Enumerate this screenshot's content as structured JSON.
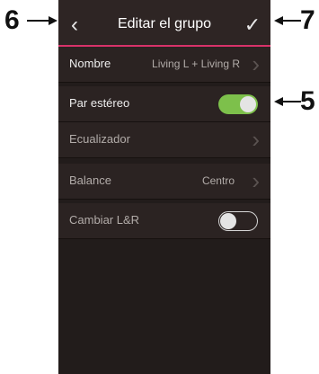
{
  "header": {
    "title": "Editar el grupo",
    "back_icon": "chevron-left-icon",
    "confirm_icon": "checkmark-icon",
    "accent_color": "#d8326a"
  },
  "settings": {
    "name": {
      "label": "Nombre",
      "value": "Living L + Living R"
    },
    "stereo_pair": {
      "label": "Par estéreo",
      "enabled": true
    },
    "equalizer": {
      "label": "Ecualizador"
    },
    "balance": {
      "label": "Balance",
      "value": "Centro"
    },
    "swap_lr": {
      "label": "Cambiar L&R",
      "enabled": false
    }
  },
  "callouts": {
    "back": "6",
    "confirm": "7",
    "stereo_toggle": "5"
  },
  "colors": {
    "toggle_on": "#7dc04b",
    "background": "#221c1b"
  }
}
